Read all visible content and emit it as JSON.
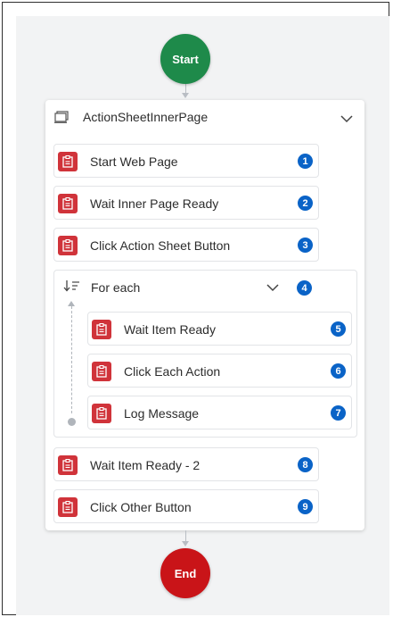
{
  "flow": {
    "start_label": "Start",
    "end_label": "End",
    "container": {
      "title": "ActionSheetInnerPage",
      "steps_before": [
        {
          "label": "Start Web Page",
          "number": "1"
        },
        {
          "label": "Wait Inner Page Ready",
          "number": "2"
        },
        {
          "label": "Click Action Sheet Button",
          "number": "3"
        }
      ],
      "loop": {
        "title": "For each",
        "number": "4",
        "steps": [
          {
            "label": "Wait Item Ready",
            "number": "5"
          },
          {
            "label": "Click Each Action",
            "number": "6"
          },
          {
            "label": "Log Message",
            "number": "7"
          }
        ]
      },
      "steps_after": [
        {
          "label": "Wait Item Ready - 2",
          "number": "8"
        },
        {
          "label": "Click Other Button",
          "number": "9"
        }
      ]
    }
  },
  "colors": {
    "start": "#1e8a4a",
    "end": "#c91418",
    "activity_icon": "#d0333a",
    "step_badge": "#0a63c7"
  },
  "icons": {
    "activity": "clipboard-icon",
    "page": "page-window-icon",
    "loop": "sort-list-icon",
    "collapse": "chevron-down-icon"
  }
}
